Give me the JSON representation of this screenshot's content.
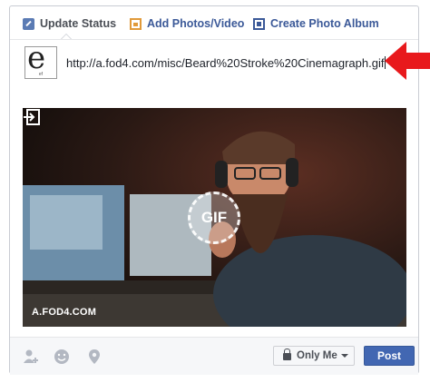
{
  "tabs": [
    {
      "label": "Update Status",
      "icon": "pencil-icon"
    },
    {
      "label": "Add Photos/Video",
      "icon": "photo-icon"
    },
    {
      "label": "Create Photo Album",
      "icon": "album-icon"
    }
  ],
  "avatar": {
    "letter": "e",
    "brand": "ef"
  },
  "status": {
    "value": "http://a.fod4.com/misc/Beard%20Stroke%20Cinemagraph.gif"
  },
  "preview": {
    "badge": "GIF",
    "domain": "A.FOD4.COM"
  },
  "footer": {
    "icons": [
      "tag-people-icon",
      "feeling-icon",
      "location-icon"
    ],
    "privacy_label": "Only Me",
    "post_label": "Post"
  },
  "colors": {
    "link": "#3b5998",
    "post_button": "#4267b2",
    "annotation_arrow": "#e8191c"
  }
}
